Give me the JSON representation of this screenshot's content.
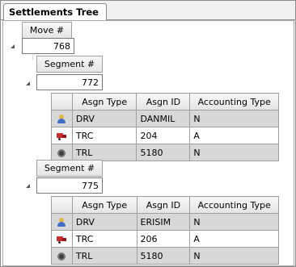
{
  "tab": {
    "label": "Settlements Tree"
  },
  "move": {
    "header": "Move #",
    "value": "768"
  },
  "columns": [
    "Asgn Type",
    "Asgn ID",
    "Accounting Type"
  ],
  "segments": [
    {
      "header": "Segment #",
      "value": "772",
      "rows": [
        {
          "icon": "driver-icon",
          "type": "DRV",
          "id": "DANMIL",
          "acct": "N"
        },
        {
          "icon": "tractor-icon",
          "type": "TRC",
          "id": "204",
          "acct": "A"
        },
        {
          "icon": "trailer-icon",
          "type": "TRL",
          "id": "5180",
          "acct": "N"
        }
      ]
    },
    {
      "header": "Segment #",
      "value": "775",
      "rows": [
        {
          "icon": "driver-icon",
          "type": "DRV",
          "id": "ERISIM",
          "acct": "N"
        },
        {
          "icon": "tractor-icon",
          "type": "TRC",
          "id": "206",
          "acct": "A"
        },
        {
          "icon": "trailer-icon",
          "type": "TRL",
          "id": "5180",
          "acct": "N"
        }
      ]
    }
  ]
}
